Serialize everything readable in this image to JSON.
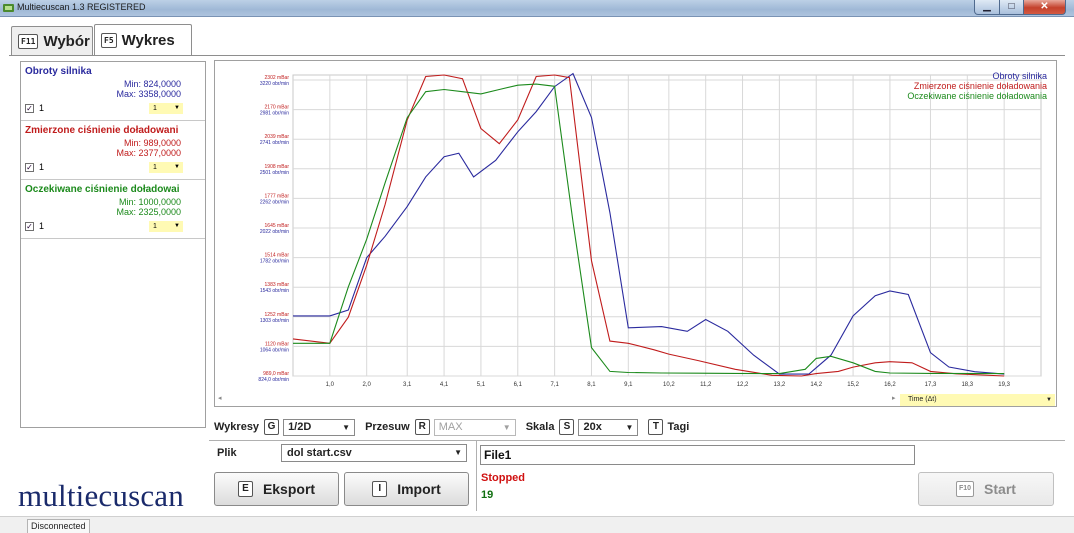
{
  "window": {
    "title": "Multiecuscan 1.3 REGISTERED"
  },
  "tabs": [
    {
      "key": "F11",
      "label": "Wybór",
      "active": false
    },
    {
      "key": "F5",
      "label": "Wykres",
      "active": true
    }
  ],
  "signals": [
    {
      "name": "Obroty silnika",
      "min": "Min: 824,0000",
      "max": "Max: 3358,0000",
      "checked": true,
      "check_label": "1",
      "drop_value": "1",
      "color": "#2a2a9e"
    },
    {
      "name": "Zmierzone ciśnienie doładowani",
      "min": "Min: 989,0000",
      "max": "Max: 2377,0000",
      "checked": true,
      "check_label": "1",
      "drop_value": "1",
      "color": "#c01c1c"
    },
    {
      "name": "Oczekiwane ciśnienie doładowai",
      "min": "Min: 1000,0000",
      "max": "Max: 2325,0000",
      "checked": true,
      "check_label": "1",
      "drop_value": "1",
      "color": "#1c8a1c"
    }
  ],
  "chart_data": {
    "type": "line",
    "legend_position": "top-right",
    "grid": true,
    "x_ticks": [
      "1,0",
      "2,0",
      "3,1",
      "4,1",
      "5,1",
      "6,1",
      "7,1",
      "8,1",
      "9,1",
      "10,2",
      "11,2",
      "12,2",
      "13,2",
      "14,2",
      "15,2",
      "16,2",
      "17,3",
      "18,3",
      "19,3"
    ],
    "xlim": [
      0,
      20.3
    ],
    "y_ticks_pressure": [
      "2302 mBar",
      "2170 mBar",
      "2039 mBar",
      "1908 mBar",
      "1777 mBar",
      "1645 mBar",
      "1514 mBar",
      "1383 mBar",
      "1252 mBar",
      "1120 mBar",
      "989,0 mBar"
    ],
    "y_ticks_rpm": [
      "3220 obr/min",
      "2981 obr/min",
      "2741 obr/min",
      "2501 obr/min",
      "2262 obr/min",
      "2022 obr/min",
      "1782 obr/min",
      "1543 obr/min",
      "1303 obr/min",
      "1064 obr/min",
      "824,0 obr/min"
    ],
    "x_axis_dropdown": "Time (Δt)",
    "series": [
      {
        "name": "Obroty silnika",
        "color": "#2a2a9e",
        "unit": "obr/min",
        "x": [
          0,
          1.0,
          1.5,
          2.0,
          2.5,
          3.1,
          3.6,
          4.1,
          4.5,
          4.9,
          5.5,
          6.1,
          6.6,
          7.1,
          7.6,
          8.1,
          8.6,
          9.1,
          10.0,
          10.7,
          11.2,
          11.8,
          12.5,
          13.2,
          14.0,
          14.6,
          15.2,
          15.8,
          16.2,
          16.7,
          17.3,
          17.8,
          18.5,
          19.3
        ],
        "y": [
          1330,
          1330,
          1380,
          1820,
          2000,
          2250,
          2500,
          2670,
          2700,
          2500,
          2640,
          2880,
          3050,
          3260,
          3370,
          3000,
          2200,
          1230,
          1240,
          1200,
          1300,
          1200,
          1000,
          840,
          840,
          1000,
          1330,
          1500,
          1540,
          1510,
          1020,
          900,
          860,
          840
        ]
      },
      {
        "name": "Zmierzone ciśnienie doładowania",
        "color": "#c01c1c",
        "unit": "mBar",
        "x": [
          0,
          1.0,
          1.5,
          2.0,
          2.5,
          3.1,
          3.6,
          4.1,
          4.6,
          5.1,
          5.6,
          6.1,
          6.6,
          7.1,
          7.5,
          8.1,
          8.6,
          9.1,
          9.8,
          10.2,
          11.0,
          12.0,
          13.0,
          13.8,
          14.2,
          14.8,
          15.2,
          15.8,
          16.2,
          16.8,
          17.3,
          18.0,
          19.3
        ],
        "y": [
          1160,
          1140,
          1260,
          1500,
          1780,
          2170,
          2370,
          2377,
          2360,
          2130,
          2060,
          2170,
          2370,
          2377,
          2365,
          1520,
          1150,
          1140,
          1110,
          1090,
          1060,
          1020,
          992,
          989,
          1000,
          1010,
          1030,
          1050,
          1055,
          1050,
          1010,
          999,
          989
        ]
      },
      {
        "name": "Oczekiwane ciśnienie doładowania",
        "color": "#1c8a1c",
        "unit": "mBar",
        "x": [
          0,
          1.0,
          1.5,
          2.0,
          2.5,
          3.1,
          3.6,
          4.1,
          4.6,
          5.1,
          5.6,
          6.1,
          6.6,
          7.1,
          7.6,
          8.1,
          8.6,
          9.1,
          10.0,
          11.0,
          12.0,
          13.2,
          13.9,
          14.2,
          14.6,
          15.2,
          15.8,
          16.2,
          17.3,
          19.3
        ],
        "y": [
          1140,
          1140,
          1400,
          1620,
          1880,
          2180,
          2300,
          2310,
          2300,
          2290,
          2310,
          2330,
          2335,
          2325,
          1700,
          1120,
          1010,
          1005,
          1003,
          1002,
          1001,
          1000,
          1020,
          1070,
          1080,
          1050,
          1010,
          1003,
          1001,
          1000
        ]
      }
    ]
  },
  "controls": {
    "wykresy_label": "Wykresy",
    "wykresy_key": "G",
    "wykresy_value": "1/2D",
    "przesuw_label": "Przesuw",
    "przesuw_key": "R",
    "przesuw_value": "MAX",
    "skala_label": "Skala",
    "skala_key": "S",
    "skala_value": "20x",
    "tagi_key": "T",
    "tagi_label": "Tagi"
  },
  "file": {
    "label": "Plik",
    "selected": "dol start.csv",
    "name_value": "File1"
  },
  "buttons": {
    "export_key": "E",
    "export_label": "Eksport",
    "import_key": "I",
    "import_label": "Import",
    "start_key": "F10",
    "start_label": "Start"
  },
  "status": {
    "state": "Stopped",
    "count": "19",
    "connection": "Disconnected"
  },
  "brand": "multiecuscan"
}
